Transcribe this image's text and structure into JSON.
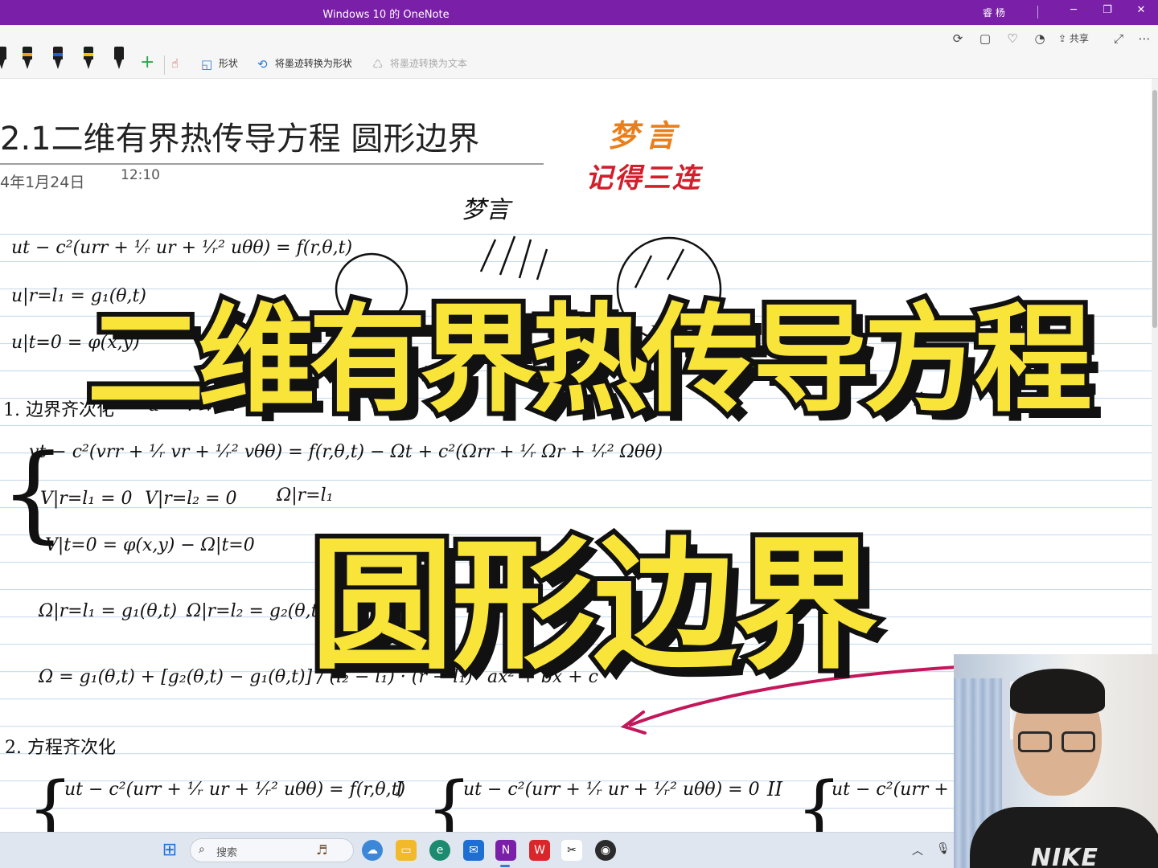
{
  "window": {
    "title": "Windows 10 的 OneNote",
    "user": "睿 杨",
    "minimize_label": "─",
    "restore_label": "❐",
    "close_label": "✕"
  },
  "ribbon": {
    "top_icons": [
      "sync-icon",
      "page-view-icon",
      "lightbulb-icon",
      "bell-icon",
      "share-icon",
      "expand-icon",
      "more-icon"
    ],
    "share_label": "共享",
    "tools": {
      "shapes_label": "形状",
      "ink_to_shape_label": "将墨迹转换为形状",
      "ink_to_text_label": "将墨迹转换为文本"
    },
    "pen_band_colors": [
      "#e8a21b",
      "#1f5fd1",
      "#f2c500",
      "#1d1d1d"
    ],
    "add_pen_label": "+"
  },
  "note": {
    "title": "2.1二维有界热传导方程 圆形边界",
    "date": "4年1月24日",
    "time": "12:10"
  },
  "brand": {
    "name": "梦言",
    "call_to_action": "记得三连",
    "scribble": "梦言"
  },
  "handwriting": {
    "pde": "ut − c²(urr + ¹⁄ᵣ ur + ¹⁄ᵣ² uθθ) = f(r,θ,t)",
    "bc": "u|r=l₁ = g₁(θ,t)",
    "ic": "u|t=0 = φ(x,y)",
    "step1": "1. 边界齐次化",
    "step1_sub": "u = v + Ω",
    "eq_v": "vt − c²(vrr + ¹⁄ᵣ vr + ¹⁄ᵣ² vθθ) = f(r,θ,t) − Ωt + c²(Ωrr + ¹⁄ᵣ Ωr + ¹⁄ᵣ² Ωθθ)",
    "v_bc1": "V|r=l₁ = 0",
    "v_bc2": "V|r=l₂ = 0",
    "omega_bc_fragment": "Ω|r=l₁",
    "v_ic": "V|t=0 = φ(x,y) − Ω|t=0",
    "omega_bc1": "Ω|r=l₁ = g₁(θ,t)",
    "omega_bc2": "Ω|r=l₂ = g₂(θ,t)",
    "omega_def": "Ω = g₁(θ,t) + [g₂(θ,t) − g₁(θ,t)] / (l₂ − l₁) · (r − l₁)",
    "quadratic": "ax² + bx + c",
    "step2": "2.  方程齐次化",
    "bottom_eq1": "ut − c²(urr + ¹⁄ᵣ ur + ¹⁄ᵣ² uθθ) = f(r,θ,t)",
    "roman1": "I",
    "bottom_eq2": "ut − c²(urr + ¹⁄ᵣ ur + ¹⁄ᵣ² uθθ) = 0",
    "roman2": "II",
    "bottom_eq3": "ut − c²(urr + ¹⁄ᵣ ur"
  },
  "overlay": {
    "main": "二维有界热传导方程",
    "sub": "圆形边界"
  },
  "webcam": {
    "shirt_text": "NIKE"
  },
  "taskbar": {
    "search_placeholder": "搜索",
    "apps": [
      "start-icon",
      "widgets-icon",
      "file-explorer-icon",
      "edge-icon",
      "mail-icon",
      "onenote-icon",
      "wps-icon",
      "capcut-icon",
      "obs-icon"
    ],
    "onenote_letter": "N",
    "wps_letter": "W"
  },
  "colors": {
    "titlebar": "#7a1fa8",
    "overlay_fill": "#f9e43a",
    "brand_name": "#e87f1c",
    "brand_cta": "#d11f2c",
    "arrow": "#c2185b"
  }
}
